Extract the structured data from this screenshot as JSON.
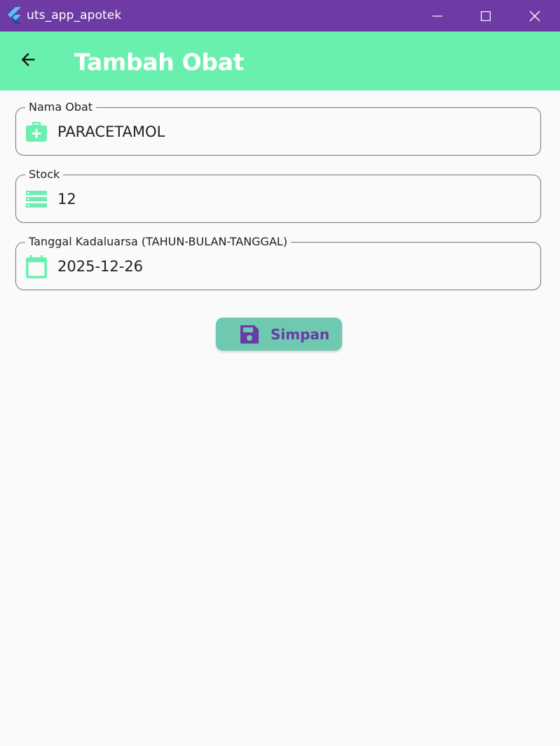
{
  "window": {
    "title": "uts_app_apotek",
    "icon": "flutter-logo-icon",
    "controls": [
      "minimize-icon",
      "maximize-icon",
      "close-icon"
    ]
  },
  "appbar": {
    "title": "Tambah Obat",
    "back_icon": "arrow-back-icon"
  },
  "form": {
    "fields": [
      {
        "label": "Nama Obat",
        "value": "PARACETAMOL",
        "icon": "medical-bag-icon"
      },
      {
        "label": "Stock",
        "value": "12",
        "icon": "storage-list-icon"
      },
      {
        "label": "Tanggal Kadaluarsa (TAHUN-BULAN-TANGGAL)",
        "value": "2025-12-26",
        "icon": "calendar-icon"
      }
    ],
    "save_label": "Simpan",
    "save_icon": "floppy-save-icon"
  },
  "colors": {
    "titlebar": "#6e3aa3",
    "appbar": "#69f0ae",
    "icon_accent": "#69f0ae",
    "button_bg": "#6ec9b0",
    "button_fg": "#6a3aa6"
  }
}
